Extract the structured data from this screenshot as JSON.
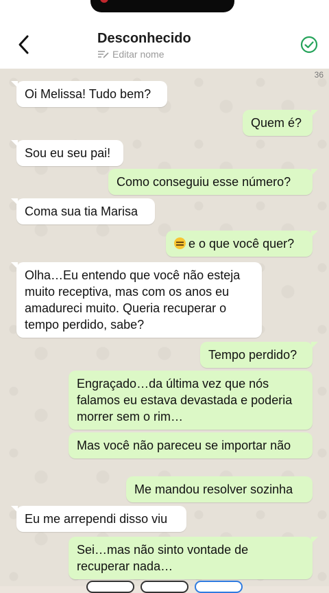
{
  "header": {
    "title": "Desconhecido",
    "subtitle": "Editar nome"
  },
  "chat": {
    "count": "36",
    "messages": [
      {
        "dir": "in",
        "text": "Oi Melissa! Tudo bem?"
      },
      {
        "dir": "out",
        "text": "Quem é?"
      },
      {
        "dir": "in",
        "text": "Sou eu seu pai!"
      },
      {
        "dir": "out",
        "text": "Como conseguiu esse número?"
      },
      {
        "dir": "in",
        "text": "Coma sua tia Marisa"
      },
      {
        "dir": "out",
        "text": "e o que você quer?"
      },
      {
        "dir": "in",
        "text": "Olha…Eu entendo que você não esteja muito receptiva, mas com os anos eu amadureci muito. Queria recuperar o tempo perdido, sabe?"
      },
      {
        "dir": "out",
        "text": "Tempo perdido?"
      },
      {
        "dir": "out",
        "text": "Engraçado…da última vez que nós falamos eu estava devastada e poderia morrer sem o rim…"
      },
      {
        "dir": "out",
        "text": "Mas você não pareceu se importar não"
      },
      {
        "dir": "out",
        "text": "Me mandou resolver sozinha"
      },
      {
        "dir": "in",
        "text": "Eu me arrependi disso viu"
      },
      {
        "dir": "out",
        "text": "Sei…mas não sinto vontade de recuperar nada…"
      }
    ]
  },
  "icons": {
    "back": "chevron-left-icon",
    "verified": "check-circle-icon",
    "edit": "edit-lines-icon",
    "emoji": "unamused-face-emoji"
  },
  "colors": {
    "incoming": "#ffffff",
    "outgoing": "#dcf8c6",
    "accent": "#25a35a"
  }
}
